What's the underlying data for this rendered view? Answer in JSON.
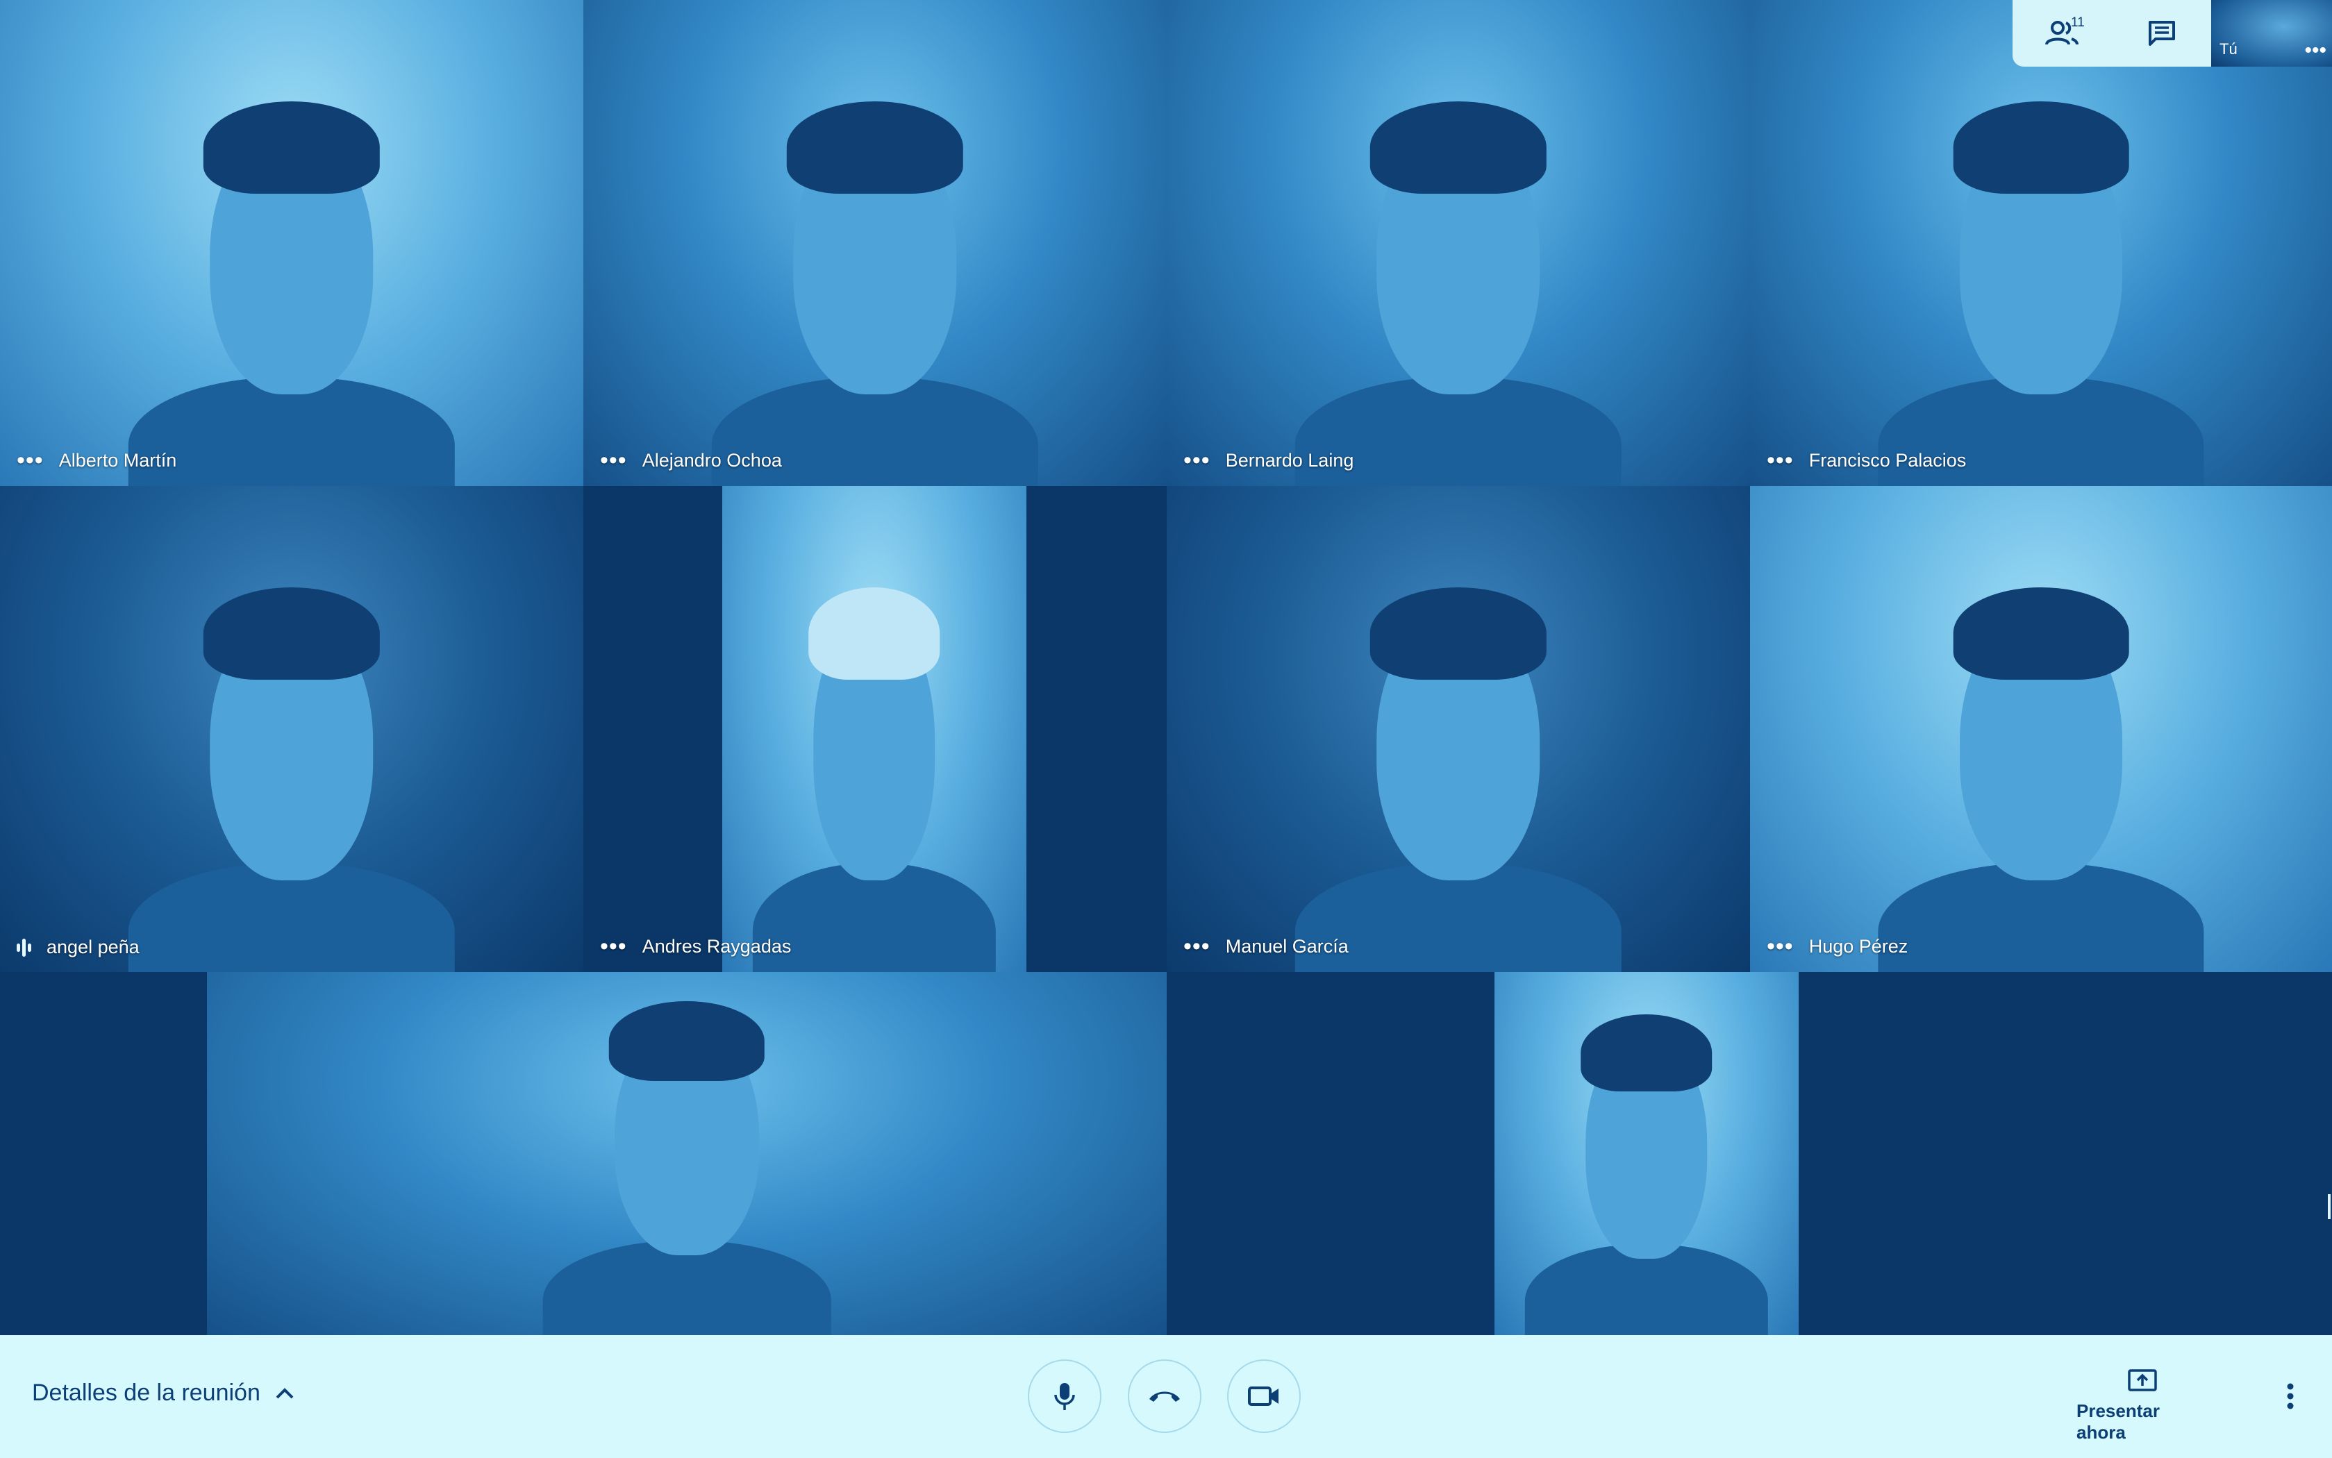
{
  "participants": [
    {
      "name": "Alberto Martín",
      "status": "more-options"
    },
    {
      "name": "Alejandro Ochoa",
      "status": "more-options"
    },
    {
      "name": "Bernardo Laing",
      "status": "more-options"
    },
    {
      "name": "Francisco Palacios",
      "status": "more-options"
    },
    {
      "name": "angel peña",
      "status": "speaking"
    },
    {
      "name": "Andres Raygadas",
      "status": "more-options"
    },
    {
      "name": "Manuel García",
      "status": "more-options"
    },
    {
      "name": "Hugo Pérez",
      "status": "more-options"
    }
  ],
  "top_panel": {
    "participants_count": "11",
    "participants_icon": "people-icon",
    "chat_icon": "chat-icon",
    "self_label": "Tú"
  },
  "bottom_bar": {
    "meeting_details_label": "Detalles de la reunión",
    "mic_icon": "microphone-icon",
    "hangup_icon": "hang-up-icon",
    "camera_icon": "video-camera-icon",
    "present_label": "Presentar ahora",
    "present_icon": "present-screen-icon",
    "more_icon": "more-vertical-icon"
  },
  "colors": {
    "tile_background": "#0a3768",
    "bar_background": "#d6f9fd",
    "accent_text": "#0b3f75"
  }
}
